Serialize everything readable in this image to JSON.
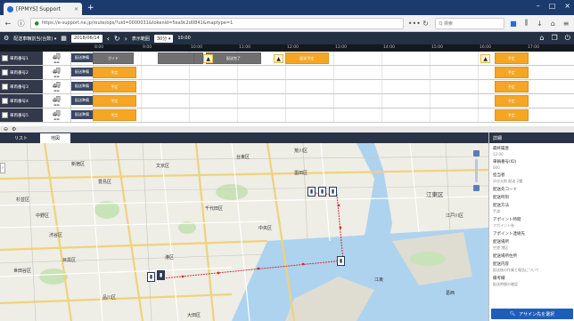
{
  "browser": {
    "tab_title": "[FPMYS] Support",
    "url": "https://e-support.ne.jp/route/ops/?uid=0000031&tokenid=5ea9c2d0841&maptype=1",
    "search_placeholder": "Q 検索"
  },
  "toolbar": {
    "group_select": "配送車輌割当(台数) ▾",
    "date_value": "2018/06/14",
    "display_label": "表示範囲",
    "range_select": "30分 ▾",
    "time_value": "10:00"
  },
  "gantt": {
    "hours": [
      "8:00",
      "9:00",
      "10:00",
      "11:00",
      "12:00",
      "13:00",
      "14:00",
      "15:00",
      "16:00",
      "17:00"
    ],
    "rows": [
      {
        "name": "車両番号1",
        "status": "配送準備",
        "blocks": [
          {
            "kind": "gray",
            "label": "ガイド",
            "start": 0.0,
            "end": 0.085
          },
          {
            "kind": "gray",
            "label": "",
            "start": 0.135,
            "end": 0.215
          },
          {
            "kind": "gray",
            "label": "",
            "start": 0.21,
            "end": 0.23
          },
          {
            "kind": "gray",
            "label": "配送完了",
            "start": 0.235,
            "end": 0.35
          },
          {
            "kind": "orange",
            "label": "配送予定",
            "start": 0.4,
            "end": 0.49
          },
          {
            "kind": "orange",
            "label": "予定",
            "start": 0.835,
            "end": 0.905
          }
        ],
        "pins": [
          0.23,
          0.376,
          0.806
        ]
      },
      {
        "name": "車両番号2",
        "status": "配送準備",
        "blocks": [
          {
            "kind": "orange",
            "label": "予定",
            "start": 0.0,
            "end": 0.09
          },
          {
            "kind": "orange",
            "label": "予定",
            "start": 0.835,
            "end": 0.905
          }
        ],
        "pins": []
      },
      {
        "name": "車両番号3",
        "status": "配送準備",
        "blocks": [
          {
            "kind": "orange",
            "label": "予定",
            "start": 0.0,
            "end": 0.09
          },
          {
            "kind": "orange",
            "label": "予定",
            "start": 0.835,
            "end": 0.905
          }
        ],
        "pins": []
      },
      {
        "name": "車両番号4",
        "status": "配送準備",
        "blocks": [
          {
            "kind": "orange",
            "label": "予定",
            "start": 0.0,
            "end": 0.09
          },
          {
            "kind": "orange",
            "label": "予定",
            "start": 0.835,
            "end": 0.905
          }
        ],
        "pins": []
      },
      {
        "name": "車両番号5",
        "status": "配送準備",
        "blocks": [
          {
            "kind": "orange",
            "label": "予定",
            "start": 0.0,
            "end": 0.09
          },
          {
            "kind": "orange",
            "label": "予定",
            "start": 0.835,
            "end": 0.905
          }
        ],
        "pins": []
      }
    ]
  },
  "panel_tabs": [
    "リスト",
    "地図"
  ],
  "map": {
    "labels": [
      {
        "text": "新宿区"
      },
      {
        "text": "文京区"
      },
      {
        "text": "台東区"
      },
      {
        "text": "墨田区"
      },
      {
        "text": "江東区"
      },
      {
        "text": "江戸川区"
      },
      {
        "text": "渋谷区"
      },
      {
        "text": "港区"
      },
      {
        "text": "中央区"
      },
      {
        "text": "千代田区"
      },
      {
        "text": "品川区"
      },
      {
        "text": "目黒区"
      },
      {
        "text": "世田谷区"
      },
      {
        "text": "江東"
      },
      {
        "text": "葛西"
      },
      {
        "text": "豊島区"
      },
      {
        "text": "大田区"
      },
      {
        "text": "杉並区"
      },
      {
        "text": "中野区"
      },
      {
        "text": "荒川区"
      }
    ]
  },
  "detail": {
    "title": "詳細",
    "fields": [
      {
        "k": "最終履歴",
        "v": "12:00"
      },
      {
        "k": "車輌番号(ID)",
        "v": "000"
      },
      {
        "k": "担当者",
        "v": "渋谷太郎  配送 2種"
      },
      {
        "k": "配送先コード",
        "v": ""
      },
      {
        "k": "配送時刻",
        "v": ""
      },
      {
        "k": "配送方法",
        "v": "手渡"
      },
      {
        "k": "アポイント時間",
        "v": "アポイント有"
      },
      {
        "k": "アポイント連絡先",
        "v": ""
      },
      {
        "k": "配送場所",
        "v": "空港  港区"
      },
      {
        "k": "配送場所住所",
        "v": ""
      },
      {
        "k": "配送内容",
        "v": "配送後の作業と報告について"
      },
      {
        "k": "備考欄",
        "v": "配送時間の確認"
      }
    ],
    "button_label": "アサイン先を選択"
  },
  "colors": {
    "accent": "#1f5dba",
    "header": "#243043",
    "planned": "#f5a623",
    "done": "#707070",
    "route": "#d23030"
  }
}
